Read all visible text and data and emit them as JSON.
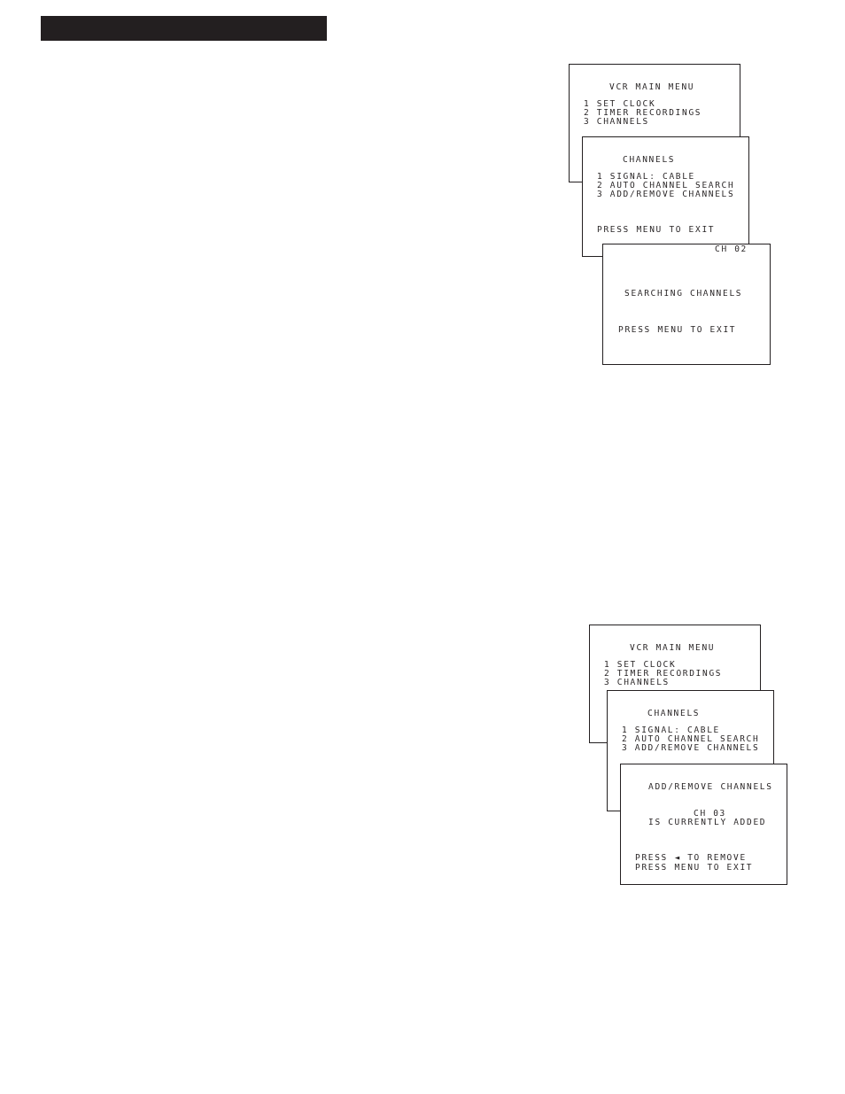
{
  "screen_stacks": [
    {
      "screens": [
        {
          "kind": "menu",
          "title": "VCR MAIN MENU",
          "items": [
            "1 SET CLOCK",
            "2 TIMER RECORDINGS",
            "3 CHANNELS"
          ]
        },
        {
          "kind": "menu",
          "title": "CHANNELS",
          "items": [
            "1 SIGNAL: CABLE",
            "2 AUTO CHANNEL SEARCH",
            "3 ADD/REMOVE CHANNELS"
          ],
          "footer": "PRESS MENU TO EXIT"
        },
        {
          "kind": "search",
          "channel": "CH 02",
          "message": "SEARCHING CHANNELS",
          "footer": "PRESS MENU TO EXIT"
        }
      ]
    },
    {
      "screens": [
        {
          "kind": "menu",
          "title": "VCR MAIN MENU",
          "items": [
            "1 SET CLOCK",
            "2 TIMER RECORDINGS",
            "3 CHANNELS"
          ]
        },
        {
          "kind": "menu",
          "title": "CHANNELS",
          "items": [
            "1 SIGNAL: CABLE",
            "2 AUTO CHANNEL SEARCH",
            "3 ADD/REMOVE CHANNELS"
          ]
        },
        {
          "kind": "channel_status",
          "title": "ADD/REMOVE CHANNELS",
          "channel": "CH 03",
          "status": "IS CURRENTLY ADDED",
          "footer_lines": [
            "PRESS ◄ TO REMOVE",
            "PRESS MENU TO EXIT"
          ]
        }
      ]
    }
  ]
}
